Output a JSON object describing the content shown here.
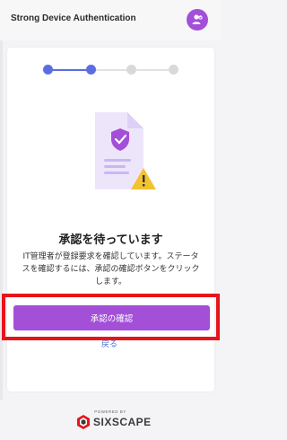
{
  "header": {
    "title": "Strong Device Authentication",
    "badge_icon": "user-check-icon"
  },
  "stepper": {
    "steps_total": 4,
    "steps_completed": 2,
    "active_color": "#5b6ee1",
    "inactive_color": "#d9d9d9"
  },
  "illustration": {
    "icon": "document-shield-warning-icon",
    "shield_color": "#a34fd8",
    "warning_color": "#f2c230"
  },
  "main": {
    "heading": "承認を待っています",
    "description": "IT管理者が登録要求を確認しています。ステータスを確認するには、承認の確認ボタンをクリックします。",
    "confirm_button": "承認の確認",
    "back_link": "戻る"
  },
  "footer": {
    "powered_by": "POWERED BY",
    "brand": "SIXSCAPE"
  },
  "colors": {
    "accent": "#a34fd8",
    "highlight": "#e8141c",
    "link": "#4a6fdc"
  }
}
